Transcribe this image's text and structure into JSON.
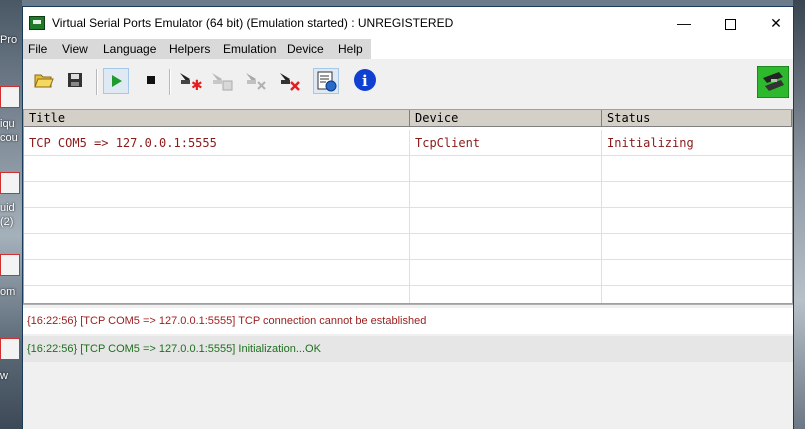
{
  "window": {
    "title": "Virtual Serial Ports Emulator (64 bit) (Emulation started) : UNREGISTERED",
    "controls": {
      "minimize": "—",
      "close": "✕"
    }
  },
  "menu": [
    "File",
    "View",
    "Language",
    "Helpers",
    "Emulation",
    "Device",
    "Help"
  ],
  "toolbar": {
    "buttons": [
      "open-icon",
      "save-icon",
      "play-icon",
      "stop-icon",
      "add-device-icon",
      "edit-device-icon",
      "disconnect-device-icon",
      "delete-device-icon",
      "serial-config-icon",
      "info-icon"
    ],
    "info_glyph": "i"
  },
  "table": {
    "columns": [
      "Title",
      "Device",
      "Status"
    ],
    "rows": [
      {
        "title": "TCP COM5 => 127.0.0.1:5555",
        "device": "TcpClient",
        "status": "Initializing"
      }
    ]
  },
  "log": [
    {
      "text": "{16:22:56} [TCP COM5 => 127.0.0.1:5555] TCP connection cannot be established",
      "color": "#9b1c1c"
    },
    {
      "text": "{16:22:56} [TCP COM5 => 127.0.0.1:5555] Initialization...OK",
      "color": "#1f6f1f"
    }
  ],
  "desktop": {
    "labels": [
      "Pro",
      "iqu",
      "cou",
      "uid",
      "(2)",
      "om",
      "w"
    ]
  },
  "colors": {
    "error": "#9b1c1c",
    "ok": "#1f6f1f",
    "row_text": "#8b1a1a"
  }
}
